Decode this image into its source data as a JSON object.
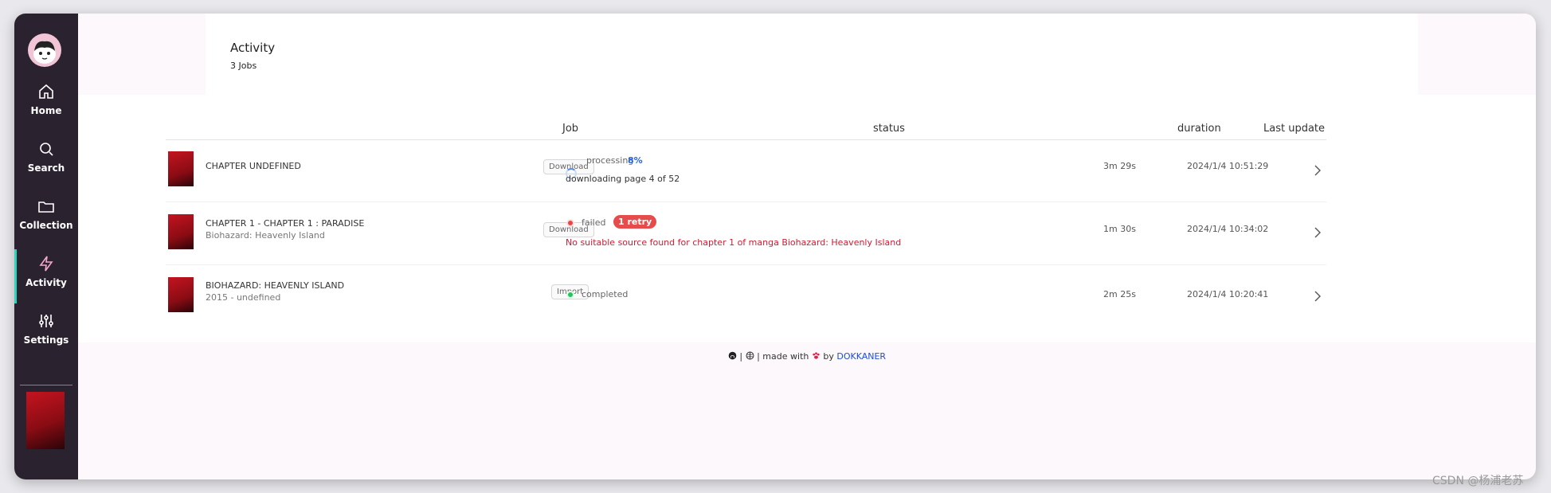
{
  "sidebar": {
    "items": [
      {
        "label": "Home",
        "icon": "home-icon"
      },
      {
        "label": "Search",
        "icon": "search-icon"
      },
      {
        "label": "Collection",
        "icon": "folder-icon"
      },
      {
        "label": "Activity",
        "icon": "lightning-icon",
        "active": true
      },
      {
        "label": "Settings",
        "icon": "sliders-icon"
      }
    ]
  },
  "header": {
    "title": "Activity",
    "subtitle": "3 Jobs"
  },
  "table": {
    "columns": {
      "job": "Job",
      "status": "status",
      "duration": "duration",
      "last_update": "Last update"
    },
    "rows": [
      {
        "name": "CHAPTER UNDEFINED",
        "subtitle": "",
        "job": "Download",
        "status": "processing",
        "progress": "8%",
        "detail": "downloading page 4 of 52",
        "duration": "3m 29s",
        "last_update": "2024/1/4 10:51:29"
      },
      {
        "name": "CHAPTER 1 - CHAPTER 1 : PARADISE",
        "subtitle": "Biohazard: Heavenly Island",
        "job": "Download",
        "status": "failed",
        "retry": "1 retry",
        "error": "No suitable source found for chapter 1 of manga Biohazard: Heavenly Island",
        "duration": "1m 30s",
        "last_update": "2024/1/4 10:34:02"
      },
      {
        "name": "BIOHAZARD: HEAVENLY ISLAND",
        "subtitle": "2015 - undefined",
        "job": "Import",
        "status": "completed",
        "duration": "2m 25s",
        "last_update": "2024/1/4 10:20:41"
      }
    ]
  },
  "footer": {
    "made_with": "| made with",
    "by": "by",
    "author": "DOKKANER"
  },
  "watermark": "CSDN @杨浦老苏",
  "colors": {
    "sidebar_bg": "#2b2230",
    "active_accent": "#2dd4bf",
    "progress": "#2563eb",
    "error": "#c81e35",
    "success": "#22c55e",
    "failed_dot": "#ef4444"
  }
}
